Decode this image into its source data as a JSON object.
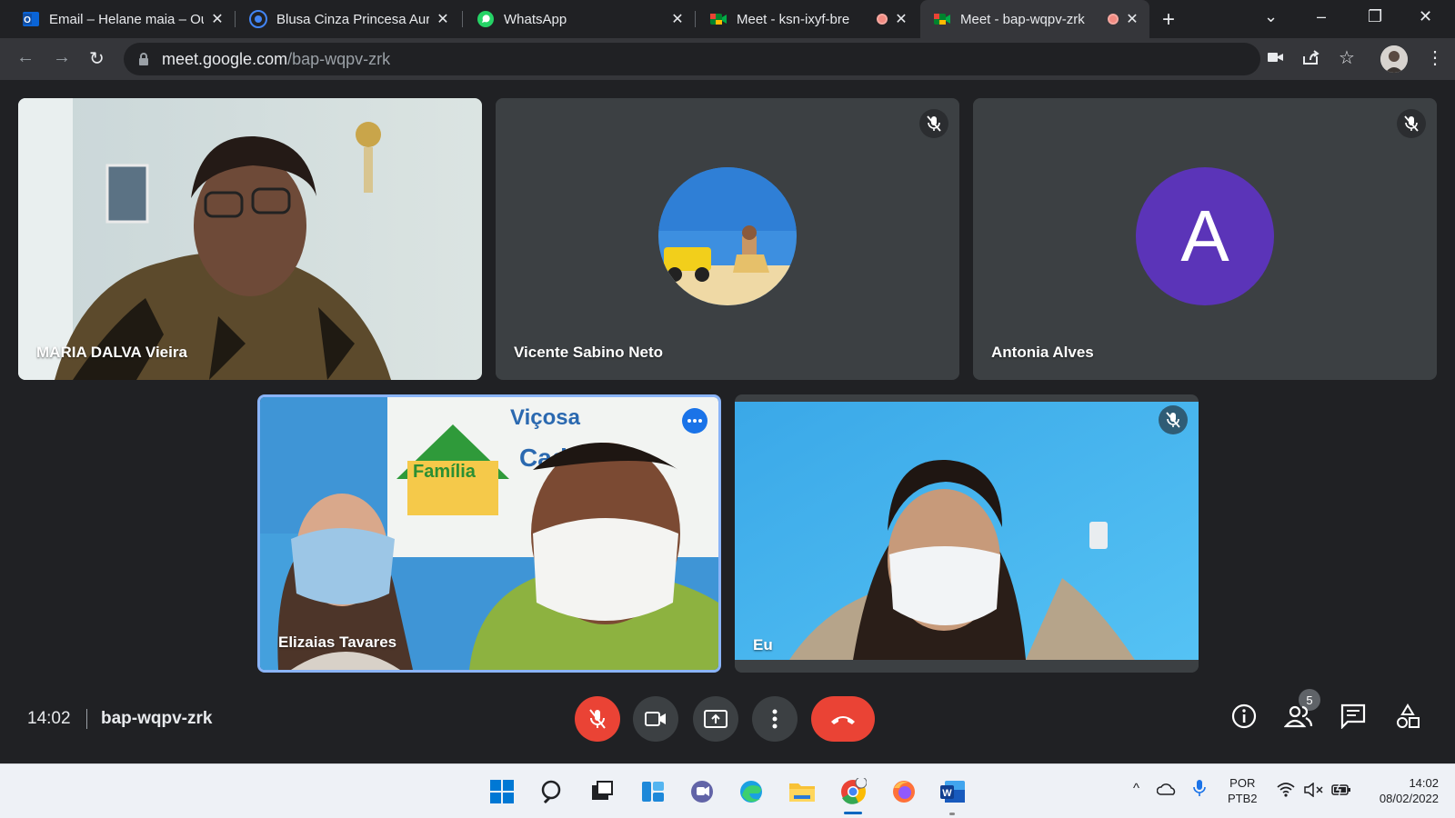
{
  "browser": {
    "tabs": [
      {
        "title": "Email – Helane maia – Out",
        "icon": "outlook-icon"
      },
      {
        "title": "Blusa Cinza Princesa Auro",
        "icon": "shop-icon"
      },
      {
        "title": "WhatsApp",
        "icon": "whatsapp-icon"
      },
      {
        "title": "Meet - ksn-ixyf-bre",
        "icon": "meet-icon"
      },
      {
        "title": "Meet - bap-wqpv-zrk",
        "icon": "meet-icon"
      }
    ],
    "url_host": "meet.google.com",
    "url_path": "/bap-wqpv-zrk"
  },
  "meeting": {
    "participants": [
      {
        "name": "MARIA DALVA Vieira",
        "muted": false,
        "video": true
      },
      {
        "name": "Vicente Sabino Neto",
        "muted": true,
        "video": false
      },
      {
        "name": "Antonia Alves",
        "muted": true,
        "video": false,
        "initial": "A"
      },
      {
        "name": "Elizaias Tavares",
        "muted": false,
        "video": true,
        "speaking": true
      },
      {
        "name": "Eu",
        "muted": true,
        "video": true
      }
    ],
    "time": "14:02",
    "code": "bap-wqpv-zrk",
    "participant_count": "5",
    "colors": {
      "end_call": "#ea4335",
      "mic_off": "#ea4335",
      "avatar_letter_bg": "#5b34b8",
      "active_speaker_border": "#8ab4f8"
    }
  },
  "taskbar": {
    "language_line1": "POR",
    "language_line2": "PTB2",
    "clock_time": "14:02",
    "clock_date": "08/02/2022",
    "apps": [
      "windows-start-icon",
      "search-icon",
      "task-view-icon",
      "widgets-icon",
      "teams-chat-icon",
      "edge-icon",
      "file-explorer-icon",
      "chrome-icon",
      "firefox-icon",
      "word-icon"
    ]
  }
}
